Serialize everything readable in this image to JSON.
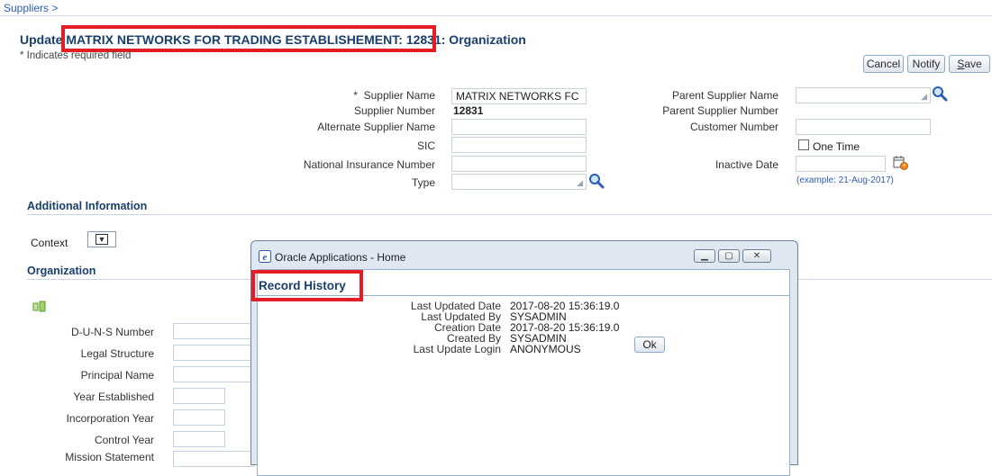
{
  "breadcrumb": {
    "label": "Suppliers",
    "separator": ">"
  },
  "header": {
    "title_prefix": "Update",
    "title_name": "MATRIX NETWORKS FOR TRADING ESTABLISHEMENT",
    "title_suffix": ": 12831: Organization",
    "required_note": "* Indicates required field"
  },
  "actions": {
    "cancel": "Cancel",
    "notify": "Notify",
    "save_rest": "ave",
    "save_underlined": "S"
  },
  "form_left": {
    "required_star": "*",
    "supplier_name_label": "Supplier Name",
    "supplier_name_value": "MATRIX NETWORKS FC",
    "supplier_number_label": "Supplier Number",
    "supplier_number_value": "12831",
    "alternate_name_label": "Alternate Supplier Name",
    "sic_label": "SIC",
    "nin_label": "National Insurance Number",
    "type_label": "Type"
  },
  "form_right": {
    "parent_name_label": "Parent Supplier Name",
    "parent_number_label": "Parent Supplier Number",
    "customer_number_label": "Customer Number",
    "one_time_label": "One Time",
    "inactive_date_label": "Inactive Date",
    "date_hint": "(example: 21-Aug-2017)"
  },
  "additional_info": {
    "title": "Additional Information",
    "context_label": "Context"
  },
  "organization": {
    "title": "Organization",
    "fields": [
      "D-U-N-S Number",
      "Legal Structure",
      "Principal Name",
      "Year Established",
      "Incorporation Year",
      "Control Year",
      "Mission Statement"
    ]
  },
  "dialog": {
    "window_title": "Oracle Applications - Home",
    "heading": "Record History",
    "rows": [
      {
        "label": "Last Updated Date",
        "value": "2017-08-20 15:36:19.0"
      },
      {
        "label": "Last Updated By",
        "value": "SYSADMIN"
      },
      {
        "label": "Creation Date",
        "value": "2017-08-20 15:36:19.0"
      },
      {
        "label": "Created By",
        "value": "SYSADMIN"
      },
      {
        "label": "Last Update Login",
        "value": "ANONYMOUS"
      }
    ],
    "ok": "Ok"
  },
  "colors": {
    "accent": "#183f6d",
    "link": "#2a5db0",
    "highlight": "#e41d24"
  }
}
